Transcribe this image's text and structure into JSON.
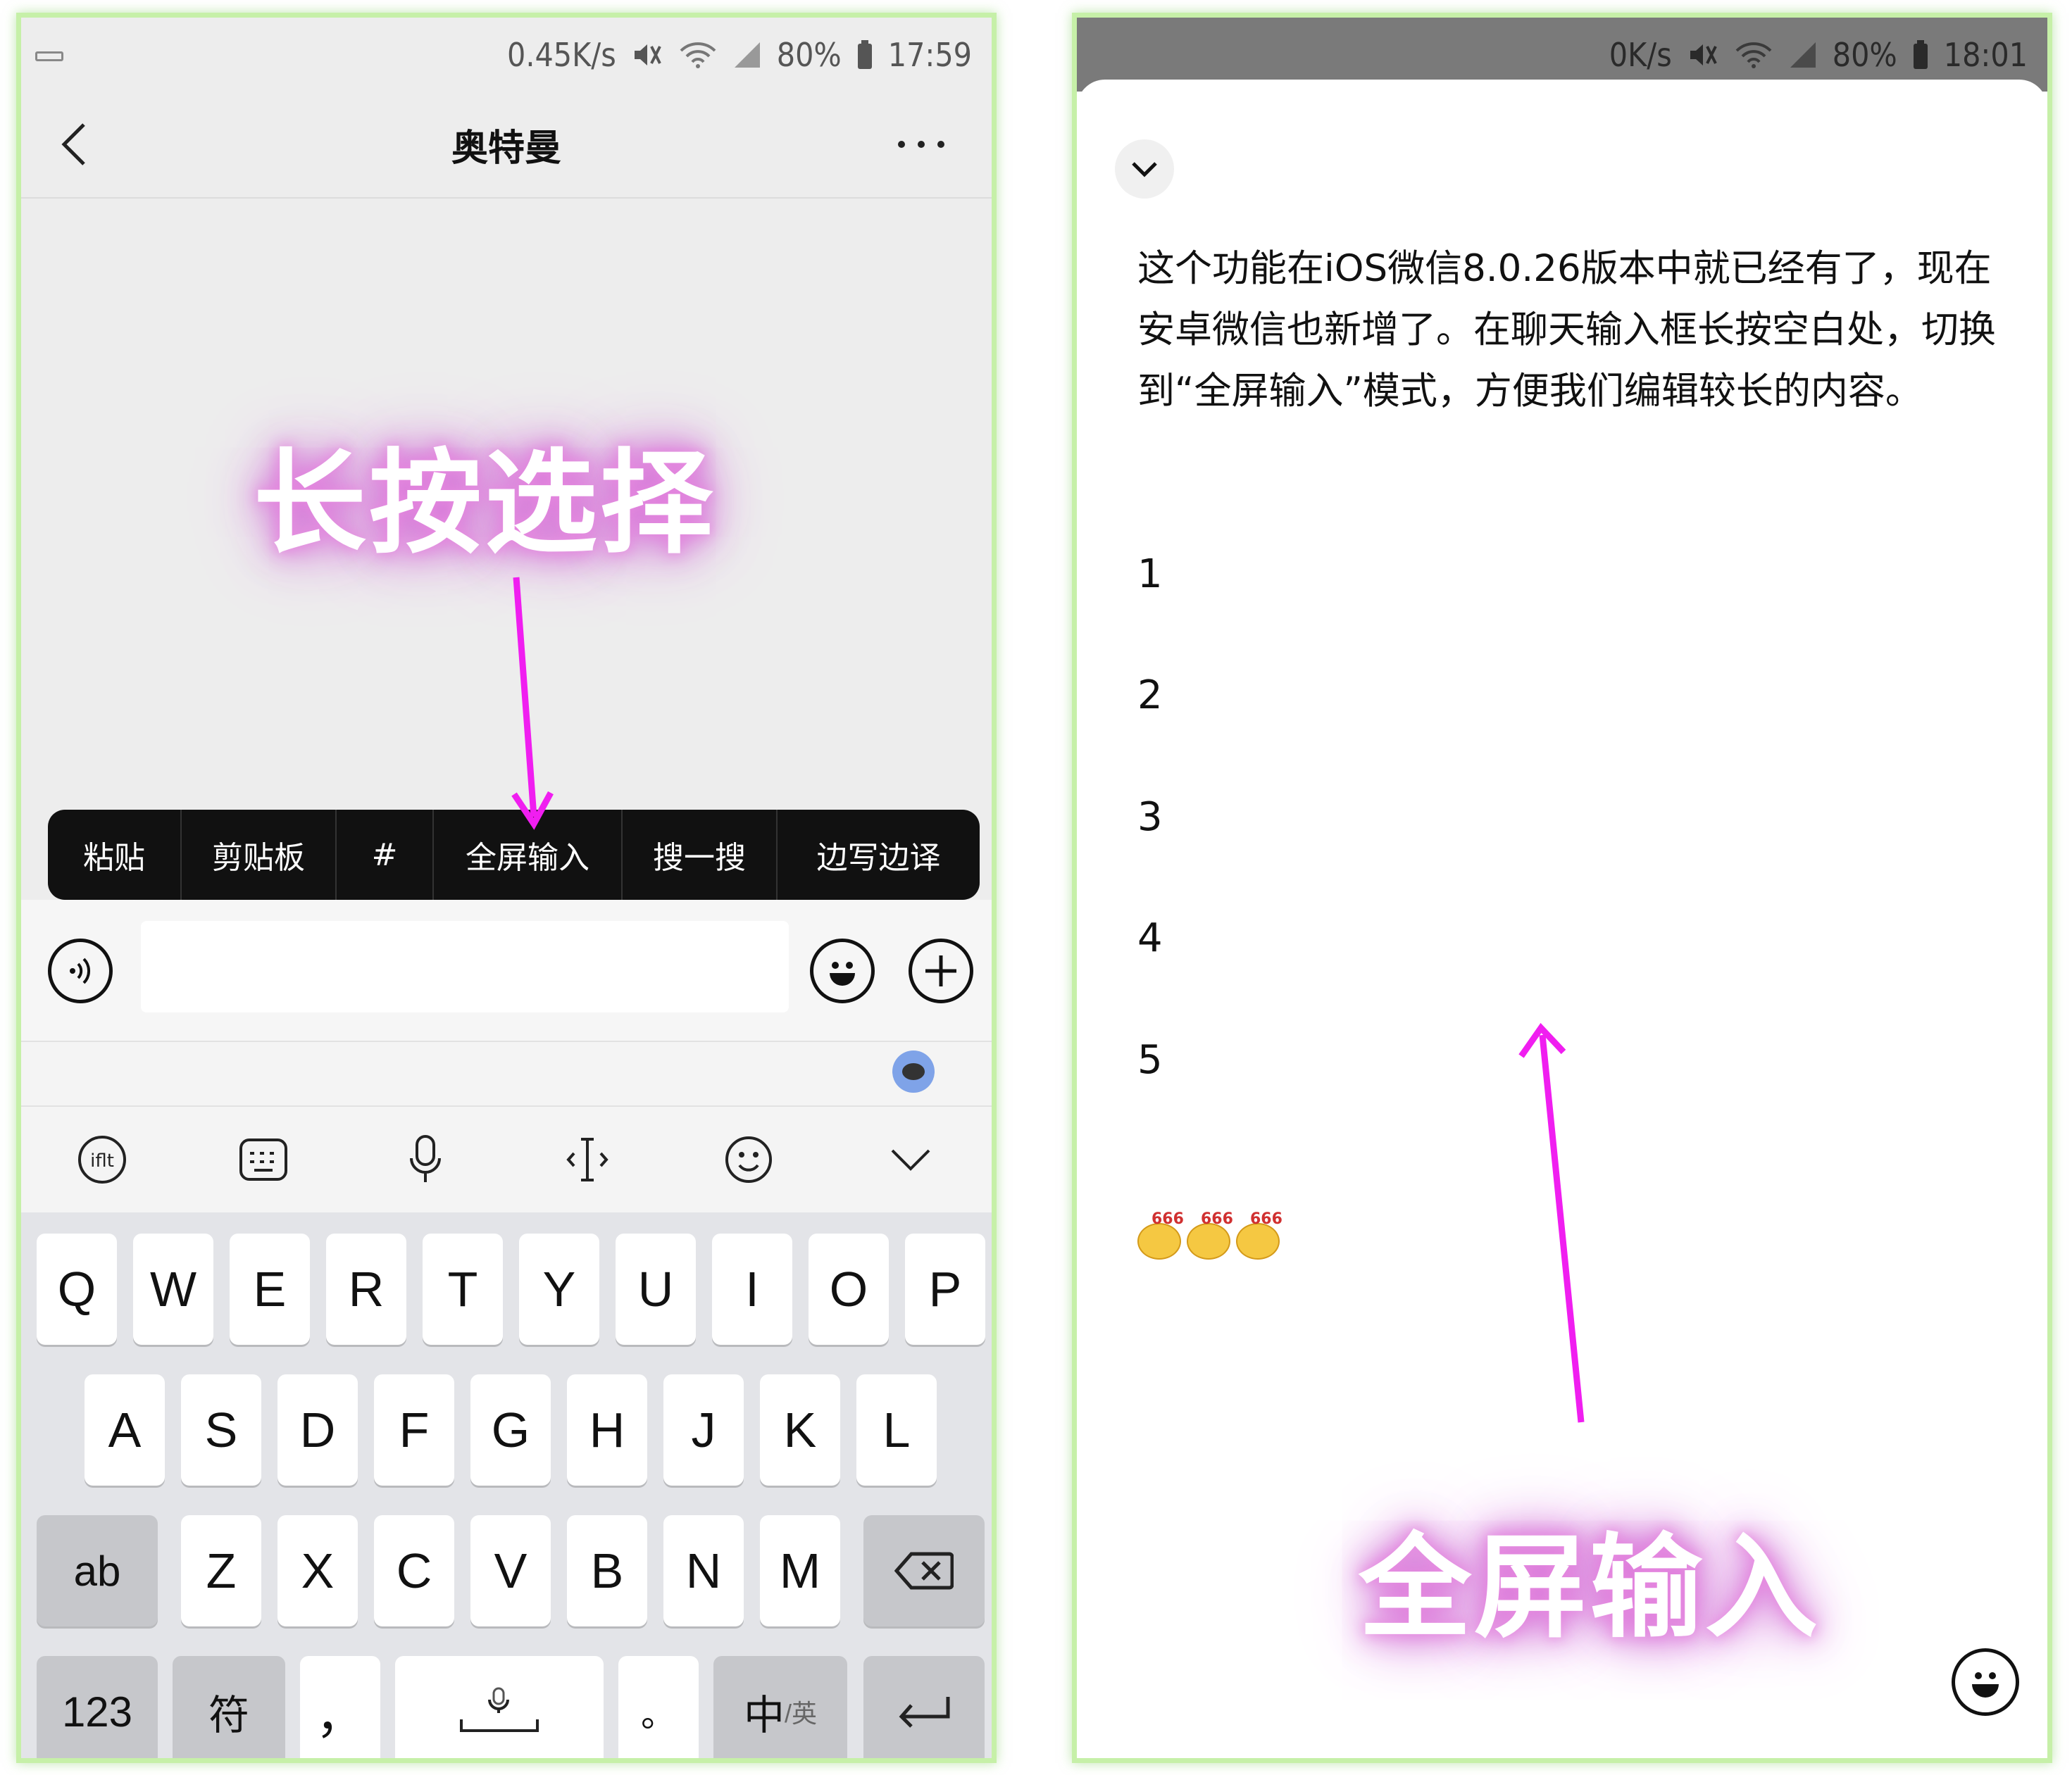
{
  "left": {
    "status": {
      "speed": "0.45K/s",
      "battery": "80%",
      "time": "17:59"
    },
    "header": {
      "title": "奥特曼"
    },
    "overlay_label": "长按选择",
    "context_menu": [
      "粘贴",
      "剪贴板",
      "#",
      "全屏输入",
      "搜一搜",
      "边写边译"
    ],
    "keyboard": {
      "row1": [
        "Q",
        "W",
        "E",
        "R",
        "T",
        "Y",
        "U",
        "I",
        "O",
        "P"
      ],
      "row2": [
        "A",
        "S",
        "D",
        "F",
        "G",
        "H",
        "J",
        "K",
        "L"
      ],
      "row3": [
        "ab",
        "Z",
        "X",
        "C",
        "V",
        "B",
        "N",
        "M"
      ],
      "row4": {
        "num": "123",
        "sym": "符",
        "comma": "，",
        "period": "。",
        "lang_main": "中",
        "lang_alt": "/英"
      }
    }
  },
  "right": {
    "status": {
      "speed": "0K/s",
      "battery": "80%",
      "time": "18:01"
    },
    "paragraph": "这个功能在iOS微信8.0.26版本中就已经有了，现在安卓微信也新增了。在聊天输入框长按空白处，切换到“全屏输入”模式，方便我们编辑较长的内容。",
    "numbers": [
      "1",
      "2",
      "3",
      "4",
      "5"
    ],
    "emoji_tag": "666",
    "overlay_label": "全屏输入"
  },
  "colors": {
    "arrow": "#f01ef0",
    "frame": "#c6f0a8"
  }
}
